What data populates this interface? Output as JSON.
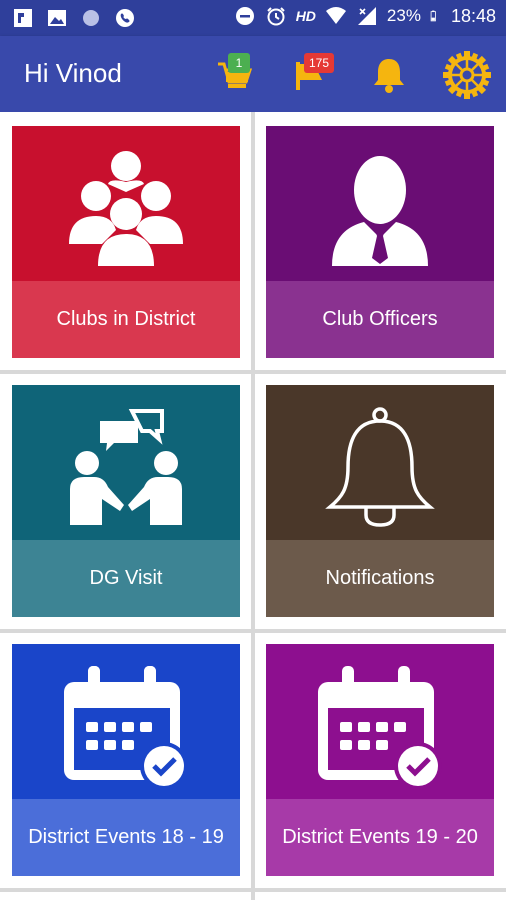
{
  "status_bar": {
    "hd": "HD",
    "battery": "23%",
    "time": "18:48"
  },
  "app_bar": {
    "title": "Hi Vinod",
    "cart_badge": "1",
    "flag_badge": "175"
  },
  "tiles": [
    {
      "label": "Clubs in District",
      "top_color": "#c8102e",
      "bottom_color": "#d9384f"
    },
    {
      "label": "Club Officers",
      "top_color": "#6a0d74",
      "bottom_color": "#8a3290"
    },
    {
      "label": "DG Visit",
      "top_color": "#0f6478",
      "bottom_color": "#3d8494"
    },
    {
      "label": "Notifications",
      "top_color": "#4a3729",
      "bottom_color": "#6c5a4b"
    },
    {
      "label": "District Events 18 - 19",
      "top_color": "#1a45c9",
      "bottom_color": "#4b6ed9"
    },
    {
      "label": "District Events 19 - 20",
      "top_color": "#8d0f8f",
      "bottom_color": "#a73aa8"
    }
  ],
  "icons": [
    "notification-app-icon",
    "image-icon",
    "circle-icon",
    "phone-icon",
    "dnd-icon",
    "alarm-icon",
    "wifi-icon",
    "signal-icon",
    "battery-icon",
    "cart-icon",
    "flag-icon",
    "bell-icon",
    "rotary-wheel-icon",
    "group-icon",
    "officer-icon",
    "meeting-icon",
    "large-bell-icon",
    "calendar-check-icon"
  ],
  "colors": {
    "status_bar": "#2f3f9b",
    "app_bar": "#3949ab",
    "accent_yellow": "#f5b50f",
    "badge_green": "#4caf50",
    "badge_red": "#e53935"
  }
}
